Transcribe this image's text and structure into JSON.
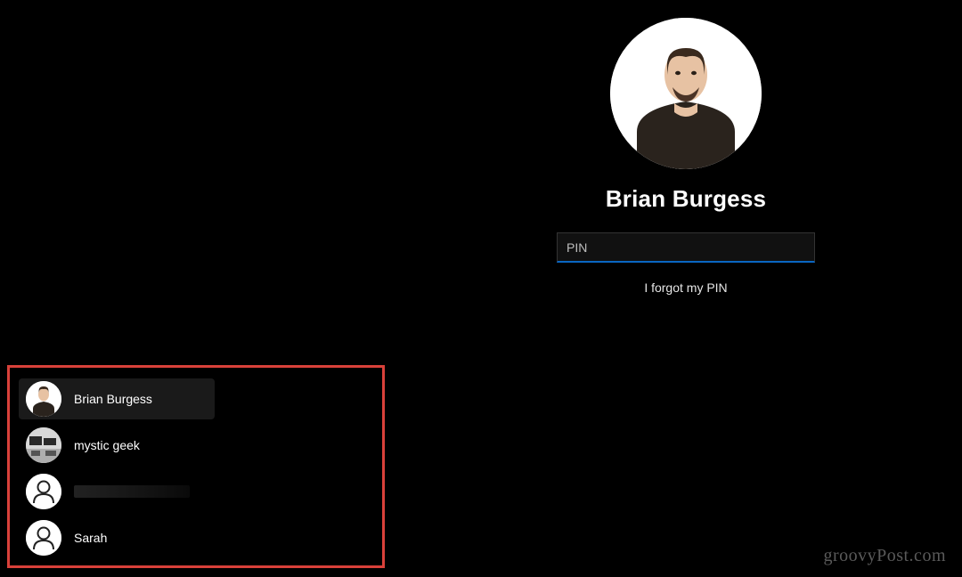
{
  "login": {
    "display_name": "Brian Burgess",
    "pin_placeholder": "PIN",
    "pin_value": "",
    "forgot_label": "I forgot my PIN",
    "accent_color": "#0a66c2"
  },
  "users": [
    {
      "name": "Brian Burgess",
      "avatar": "photo-man",
      "selected": true
    },
    {
      "name": "mystic geek",
      "avatar": "photo-desk",
      "selected": false
    },
    {
      "name": "",
      "avatar": "generic",
      "selected": false,
      "redacted": true
    },
    {
      "name": "Sarah",
      "avatar": "generic",
      "selected": false
    }
  ],
  "annotation_box_color": "#d9413a",
  "watermark": "groovyPost.com"
}
